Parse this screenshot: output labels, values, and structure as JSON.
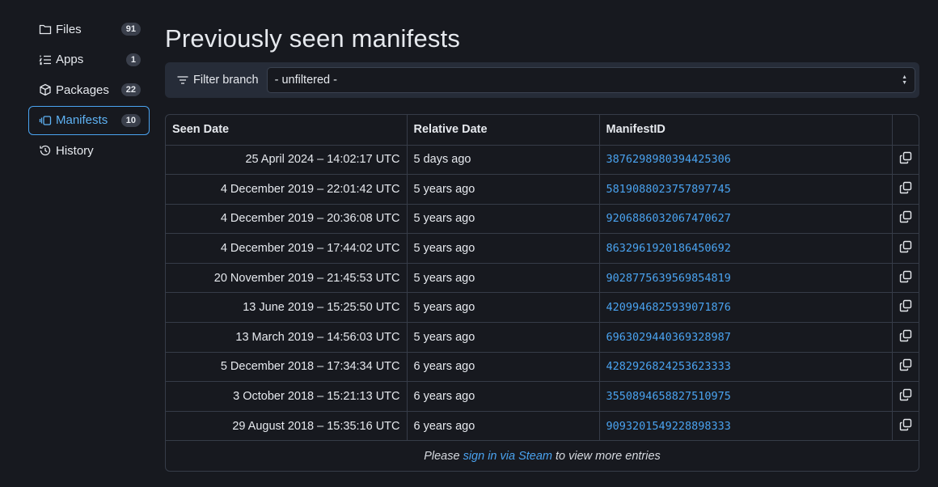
{
  "sidebar": {
    "items": [
      {
        "label": "Files",
        "count": "91",
        "icon": "folder-icon"
      },
      {
        "label": "Apps",
        "count": "1",
        "icon": "list-icon"
      },
      {
        "label": "Packages",
        "count": "22",
        "icon": "package-icon"
      },
      {
        "label": "Manifests",
        "count": "10",
        "icon": "manifests-icon",
        "active": true
      },
      {
        "label": "History",
        "icon": "history-icon"
      }
    ]
  },
  "main": {
    "title": "Previously seen manifests",
    "filter": {
      "label": "Filter branch",
      "value": "- unfiltered -"
    },
    "table": {
      "headers": [
        "Seen Date",
        "Relative Date",
        "ManifestID"
      ],
      "rows": [
        {
          "seen": "25 April 2024 – 14:02:17 UTC",
          "relative": "5 days ago",
          "id": "3876298980394425306"
        },
        {
          "seen": "4 December 2019 – 22:01:42 UTC",
          "relative": "5 years ago",
          "id": "5819088023757897745"
        },
        {
          "seen": "4 December 2019 – 20:36:08 UTC",
          "relative": "5 years ago",
          "id": "9206886032067470627"
        },
        {
          "seen": "4 December 2019 – 17:44:02 UTC",
          "relative": "5 years ago",
          "id": "8632961920186450692"
        },
        {
          "seen": "20 November 2019 – 21:45:53 UTC",
          "relative": "5 years ago",
          "id": "9028775639569854819"
        },
        {
          "seen": "13 June 2019 – 15:25:50 UTC",
          "relative": "5 years ago",
          "id": "4209946825939071876"
        },
        {
          "seen": "13 March 2019 – 14:56:03 UTC",
          "relative": "5 years ago",
          "id": "6963029440369328987"
        },
        {
          "seen": "5 December 2018 – 17:34:34 UTC",
          "relative": "6 years ago",
          "id": "4282926824253623333"
        },
        {
          "seen": "3 October 2018 – 15:21:13 UTC",
          "relative": "6 years ago",
          "id": "3550894658827510975"
        },
        {
          "seen": "29 August 2018 – 15:35:16 UTC",
          "relative": "6 years ago",
          "id": "9093201549228898333"
        }
      ],
      "footer": {
        "before": "Please ",
        "link": "sign in via Steam",
        "after": " to view more entries"
      }
    }
  },
  "colors": {
    "background": "#17191f",
    "accent": "#4aa3f0",
    "panel": "#262c38",
    "border": "#363c48"
  }
}
